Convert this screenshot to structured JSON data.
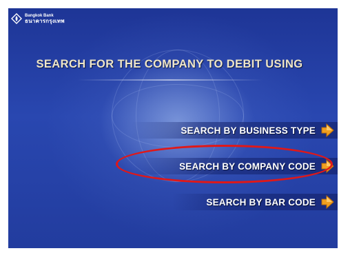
{
  "bank": {
    "name_en": "Bangkok Bank",
    "name_th": "ธนาคารกรุงเทพ",
    "logo_icon": "lotus-diamond-icon"
  },
  "screen": {
    "title": "SEARCH FOR THE COMPANY TO DEBIT USING"
  },
  "options": [
    {
      "label": "SEARCH BY BUSINESS TYPE",
      "icon": "arrow-right-icon"
    },
    {
      "label": "SEARCH BY COMPANY CODE",
      "icon": "arrow-right-icon",
      "highlighted": true
    },
    {
      "label": "SEARCH BY BAR CODE",
      "icon": "arrow-right-icon"
    }
  ],
  "colors": {
    "screen_blue": "#2947b0",
    "title_text": "#efe6c8",
    "arrow_orange": "#f0a020",
    "highlight_red": "#e01818"
  }
}
